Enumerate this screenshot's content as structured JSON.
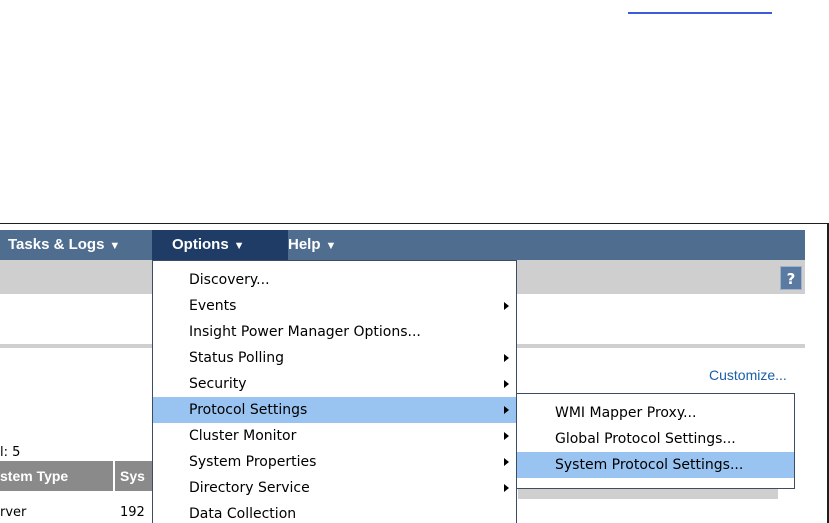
{
  "menubar": {
    "items": [
      {
        "label": "Tasks & Logs",
        "caret": "▼"
      },
      {
        "label": "Options",
        "caret": "▼"
      },
      {
        "label": "Help",
        "caret": "▼"
      }
    ]
  },
  "help_button": {
    "label": "?"
  },
  "customize_link": "Customize...",
  "total_text": "l: 5",
  "table": {
    "columns": [
      "stem Type",
      "Sys"
    ],
    "first_row": [
      "rver",
      "192"
    ]
  },
  "options_menu": {
    "items": [
      {
        "label": "Discovery..."
      },
      {
        "label": "Events"
      },
      {
        "label": "Insight Power Manager Options..."
      },
      {
        "label": "Status Polling"
      },
      {
        "label": "Security"
      },
      {
        "label": "Protocol Settings"
      },
      {
        "label": "Cluster Monitor"
      },
      {
        "label": "System Properties"
      },
      {
        "label": "Directory Service"
      },
      {
        "label": "Data Collection"
      }
    ]
  },
  "protocol_submenu": {
    "items": [
      {
        "label": "WMI Mapper Proxy..."
      },
      {
        "label": "Global Protocol Settings..."
      },
      {
        "label": "System Protocol Settings..."
      }
    ]
  },
  "colors": {
    "menubar_bg": "#4f6e8f",
    "menubar_active": "#1f3c66",
    "highlight": "#99c4f2",
    "link": "#1a5ea8"
  }
}
